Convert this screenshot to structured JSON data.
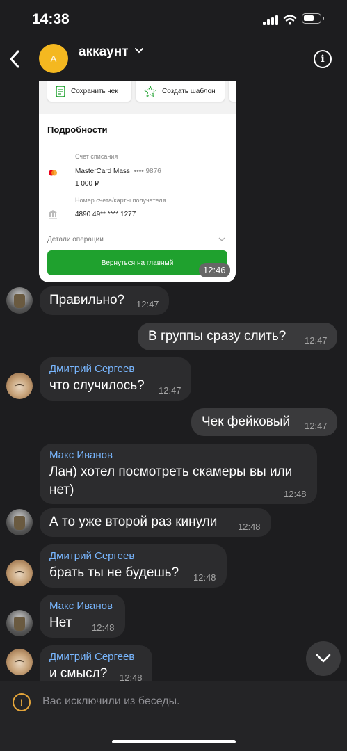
{
  "status_bar": {
    "time": "14:38"
  },
  "header": {
    "avatar_letter": "А",
    "title": "аккаунт",
    "info_icon": "info-icon"
  },
  "receipt": {
    "save_label": "Сохранить чек",
    "template_label": "Создать шаблон",
    "details_title": "Подробности",
    "debit_label": "Счет списания",
    "card_name": "MasterCard Mass",
    "card_mask": "•••• 9876",
    "amount": "1 000 ₽",
    "recipient_label": "Номер счета/карты получателя",
    "recipient_value": "4890 49** **** 1277",
    "operation_details": "Детали операции",
    "return_button": "Вернуться на главный",
    "time": "12:46"
  },
  "messages": [
    {
      "sender": "",
      "text": "Правильно?",
      "time": "12:47"
    },
    {
      "sender": "",
      "text": "В группы сразу слить?",
      "time": "12:47"
    },
    {
      "sender": "Дмитрий Сергеев",
      "text": "что случилось?",
      "time": "12:47"
    },
    {
      "sender": "",
      "text": "Чек фейковый",
      "time": "12:47"
    },
    {
      "sender": "Макс Иванов",
      "text_line1": "Лан) хотел посмотреть скамеры вы или",
      "text_line2": "нет)",
      "time": "12:48"
    },
    {
      "sender": "",
      "text": "А то уже второй раз кинули",
      "time": "12:48"
    },
    {
      "sender": "Дмитрий Сергеев",
      "text": "брать ты не будешь?",
      "time": "12:48"
    },
    {
      "sender": "Макс Иванов",
      "text": "Нет",
      "time": "12:48"
    },
    {
      "sender": "Дмитрий Сергеев",
      "text": "и смысл?",
      "time": "12:48"
    }
  ],
  "footer": {
    "excluded_text": "Вас исключили из беседы."
  },
  "colors": {
    "background": "#1d1d1f",
    "bubble_in": "#2c2c2e",
    "bubble_out": "#3a3a3c",
    "sender_name": "#79b7ff",
    "sber_green": "#1fa12e",
    "warning": "#e4a53a"
  }
}
